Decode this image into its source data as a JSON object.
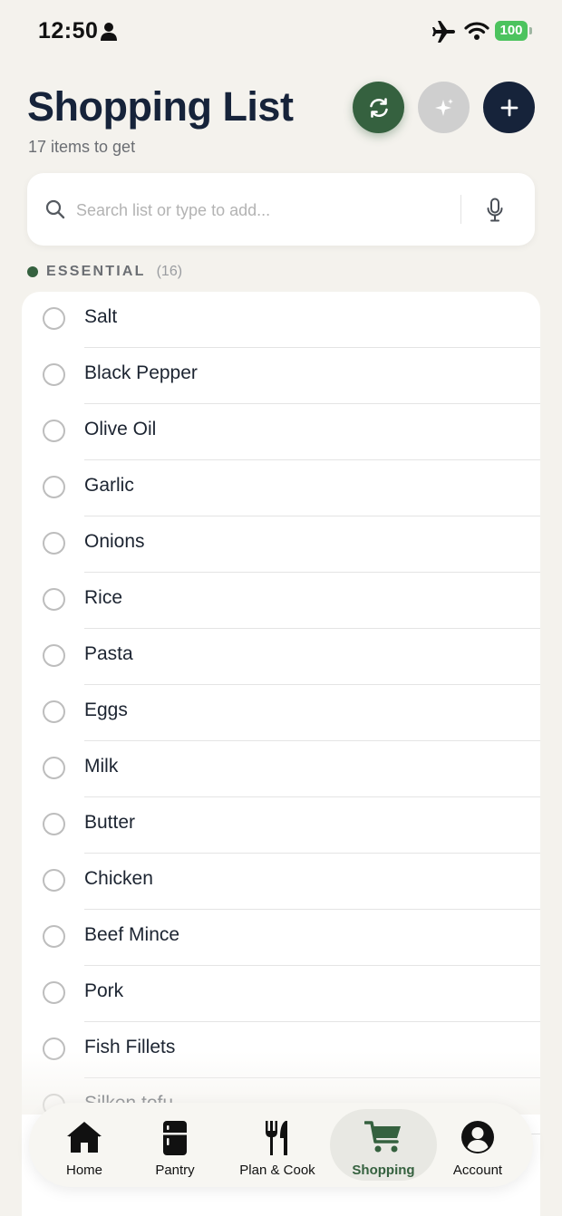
{
  "status_bar": {
    "time": "12:50",
    "battery": "100",
    "icons": [
      "person-icon",
      "airplane-icon",
      "wifi-icon",
      "battery-icon"
    ]
  },
  "header": {
    "title": "Shopping List",
    "subtitle": "17 items to get",
    "buttons": [
      {
        "name": "sync-button",
        "icon": "sync-icon",
        "color": "#35613f"
      },
      {
        "name": "ai-suggest-button",
        "icon": "sparkle-icon",
        "color": "#cfcfcf"
      },
      {
        "name": "add-button",
        "icon": "plus-icon",
        "color": "#16233a"
      }
    ]
  },
  "search": {
    "placeholder": "Search list or type to add...",
    "value": ""
  },
  "section": {
    "name": "ESSENTIAL",
    "count": "(16)",
    "color": "#35613f"
  },
  "items": [
    {
      "label": "Salt",
      "checked": false
    },
    {
      "label": "Black Pepper",
      "checked": false
    },
    {
      "label": "Olive Oil",
      "checked": false
    },
    {
      "label": "Garlic",
      "checked": false
    },
    {
      "label": "Onions",
      "checked": false
    },
    {
      "label": "Rice",
      "checked": false
    },
    {
      "label": "Pasta",
      "checked": false
    },
    {
      "label": "Eggs",
      "checked": false
    },
    {
      "label": "Milk",
      "checked": false
    },
    {
      "label": "Butter",
      "checked": false
    },
    {
      "label": "Chicken",
      "checked": false
    },
    {
      "label": "Beef Mince",
      "checked": false
    },
    {
      "label": "Pork",
      "checked": false
    },
    {
      "label": "Fish Fillets",
      "checked": false
    },
    {
      "label": "Silken tofu",
      "checked": false
    }
  ],
  "tabs": [
    {
      "label": "Home",
      "icon": "home-icon",
      "active": false
    },
    {
      "label": "Pantry",
      "icon": "fridge-icon",
      "active": false
    },
    {
      "label": "Plan & Cook",
      "icon": "fork-knife-icon",
      "active": false
    },
    {
      "label": "Shopping",
      "icon": "cart-icon",
      "active": true
    },
    {
      "label": "Account",
      "icon": "account-icon",
      "active": false
    }
  ],
  "colors": {
    "background": "#f4f2ed",
    "accent": "#35613f",
    "navy": "#16233a"
  }
}
